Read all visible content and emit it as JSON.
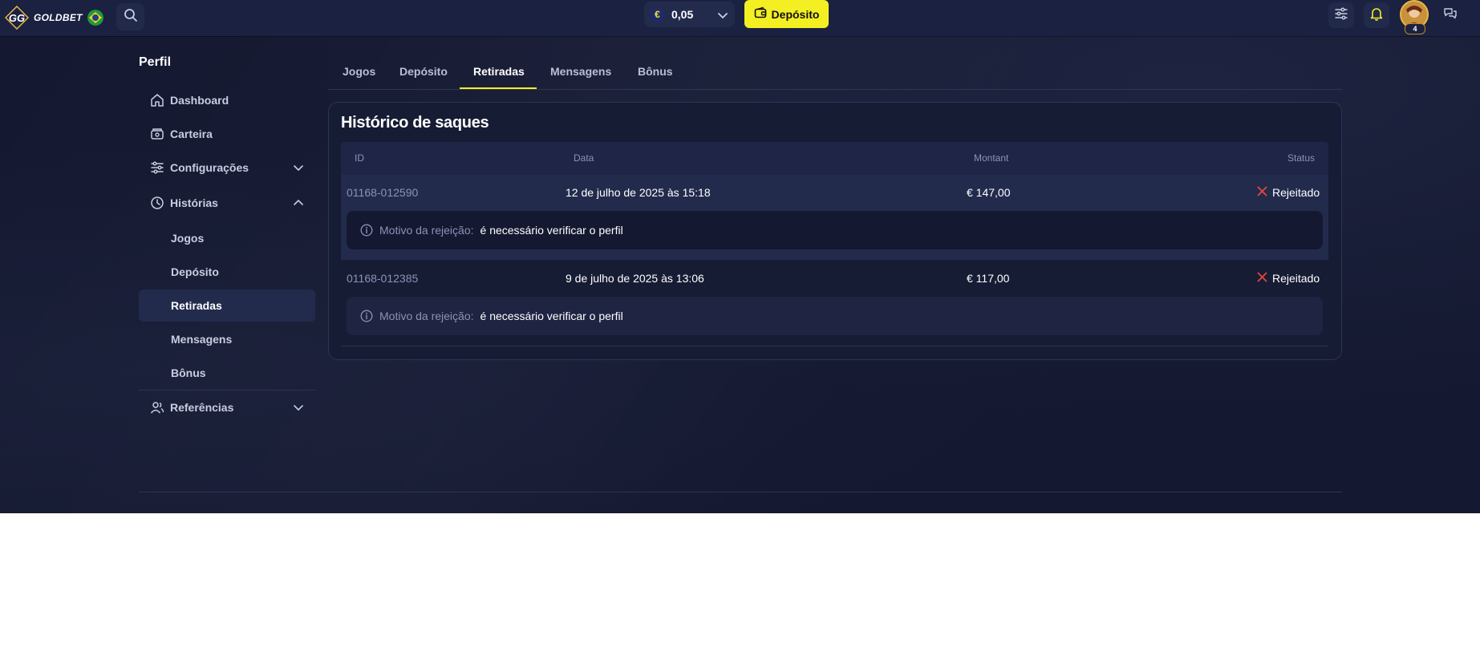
{
  "header": {
    "brand": "GOLDBET",
    "balance": "0,05",
    "currency_symbol": "€",
    "deposit_label": "Depósito",
    "avatar_level": "4"
  },
  "sidebar": {
    "title": "Perfil",
    "items": [
      {
        "label": "Dashboard",
        "icon": "home-icon"
      },
      {
        "label": "Carteira",
        "icon": "wallet-icon"
      },
      {
        "label": "Configurações",
        "icon": "sliders-icon",
        "expanded": false
      },
      {
        "label": "Histórias",
        "icon": "clock-icon",
        "expanded": true
      }
    ],
    "history_sub": [
      "Jogos",
      "Depósito",
      "Retiradas",
      "Mensagens",
      "Bônus"
    ],
    "active_sub": "Retiradas",
    "referrals": {
      "label": "Referências",
      "icon": "users-icon",
      "expanded": false
    }
  },
  "tabs": {
    "items": [
      "Jogos",
      "Depósito",
      "Retiradas",
      "Mensagens",
      "Bônus"
    ],
    "active": "Retiradas"
  },
  "withdrawals": {
    "title": "Histórico de saques",
    "columns": {
      "id": "ID",
      "date": "Data",
      "amount": "Montant",
      "status": "Status"
    },
    "rows": [
      {
        "id": "01168-012590",
        "date": "12 de julho de 2025 às 15:18",
        "amount": "€ 147,00",
        "status": "Rejeitado",
        "reason_label": "Motivo da rejeição:",
        "reason": "é necessário verificar o perfil",
        "highlighted": true
      },
      {
        "id": "01168-012385",
        "date": "9 de julho de 2025 às 13:06",
        "amount": "€ 117,00",
        "status": "Rejeitado",
        "reason_label": "Motivo da rejeição:",
        "reason": "é necessário verificar o perfil",
        "highlighted": false
      }
    ]
  },
  "colors": {
    "accent": "#f3ef23",
    "background": "#141830",
    "header": "#1b2140",
    "rejected": "#e8453c"
  }
}
